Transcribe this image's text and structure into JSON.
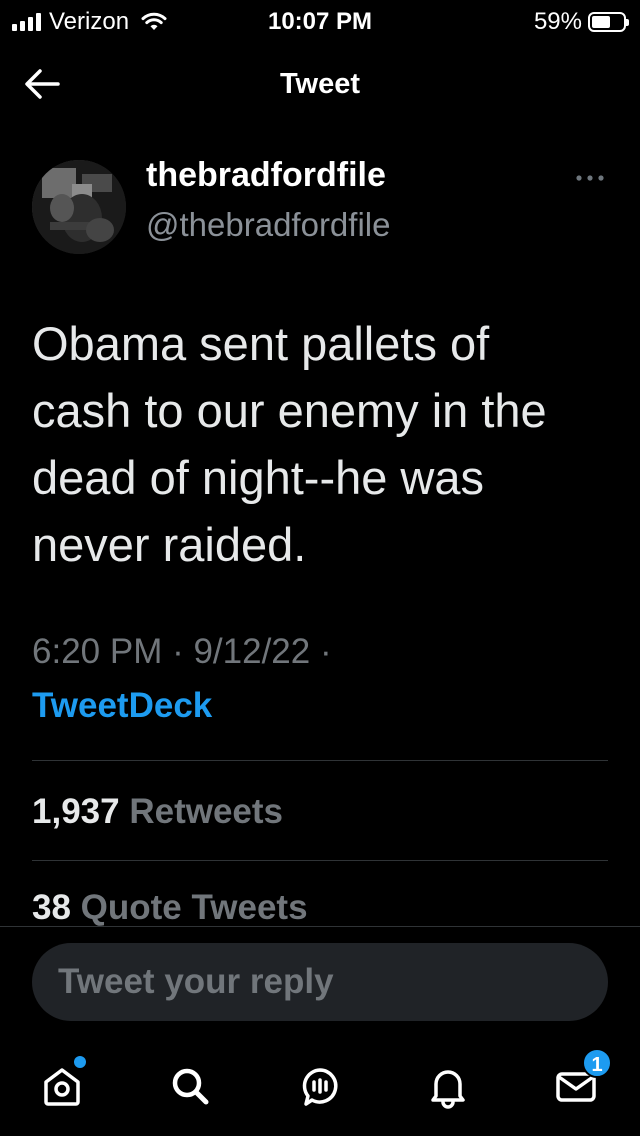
{
  "status_bar": {
    "carrier": "Verizon",
    "time": "10:07 PM",
    "battery_percent": "59%",
    "battery_level": 0.59
  },
  "header": {
    "title": "Tweet",
    "back_icon": "arrow-left-icon"
  },
  "tweet": {
    "author_name": "thebradfordfile",
    "author_handle": "@thebradfordfile",
    "text_lines": [
      "Obama sent pallets of",
      "cash to our enemy in the",
      "dead of night--he was",
      "never raided."
    ],
    "timestamp": "6:20 PM · 9/12/22 ·",
    "source": "TweetDeck"
  },
  "stats": {
    "retweets_count": "1,937",
    "retweets_label": "Retweets",
    "quotes_count": "38",
    "quotes_label": "Quote Tweets"
  },
  "reply": {
    "placeholder": "Tweet your reply"
  },
  "bottom_nav": {
    "items": [
      {
        "icon": "home-icon"
      },
      {
        "icon": "search-icon"
      },
      {
        "icon": "spaces-icon"
      },
      {
        "icon": "notifications-icon"
      },
      {
        "icon": "messages-icon",
        "badge": "1"
      }
    ]
  },
  "colors": {
    "background": "#000000",
    "accent": "#1d9bf0",
    "secondary_text": "#71767b",
    "primary_text": "#e7e9ea"
  }
}
